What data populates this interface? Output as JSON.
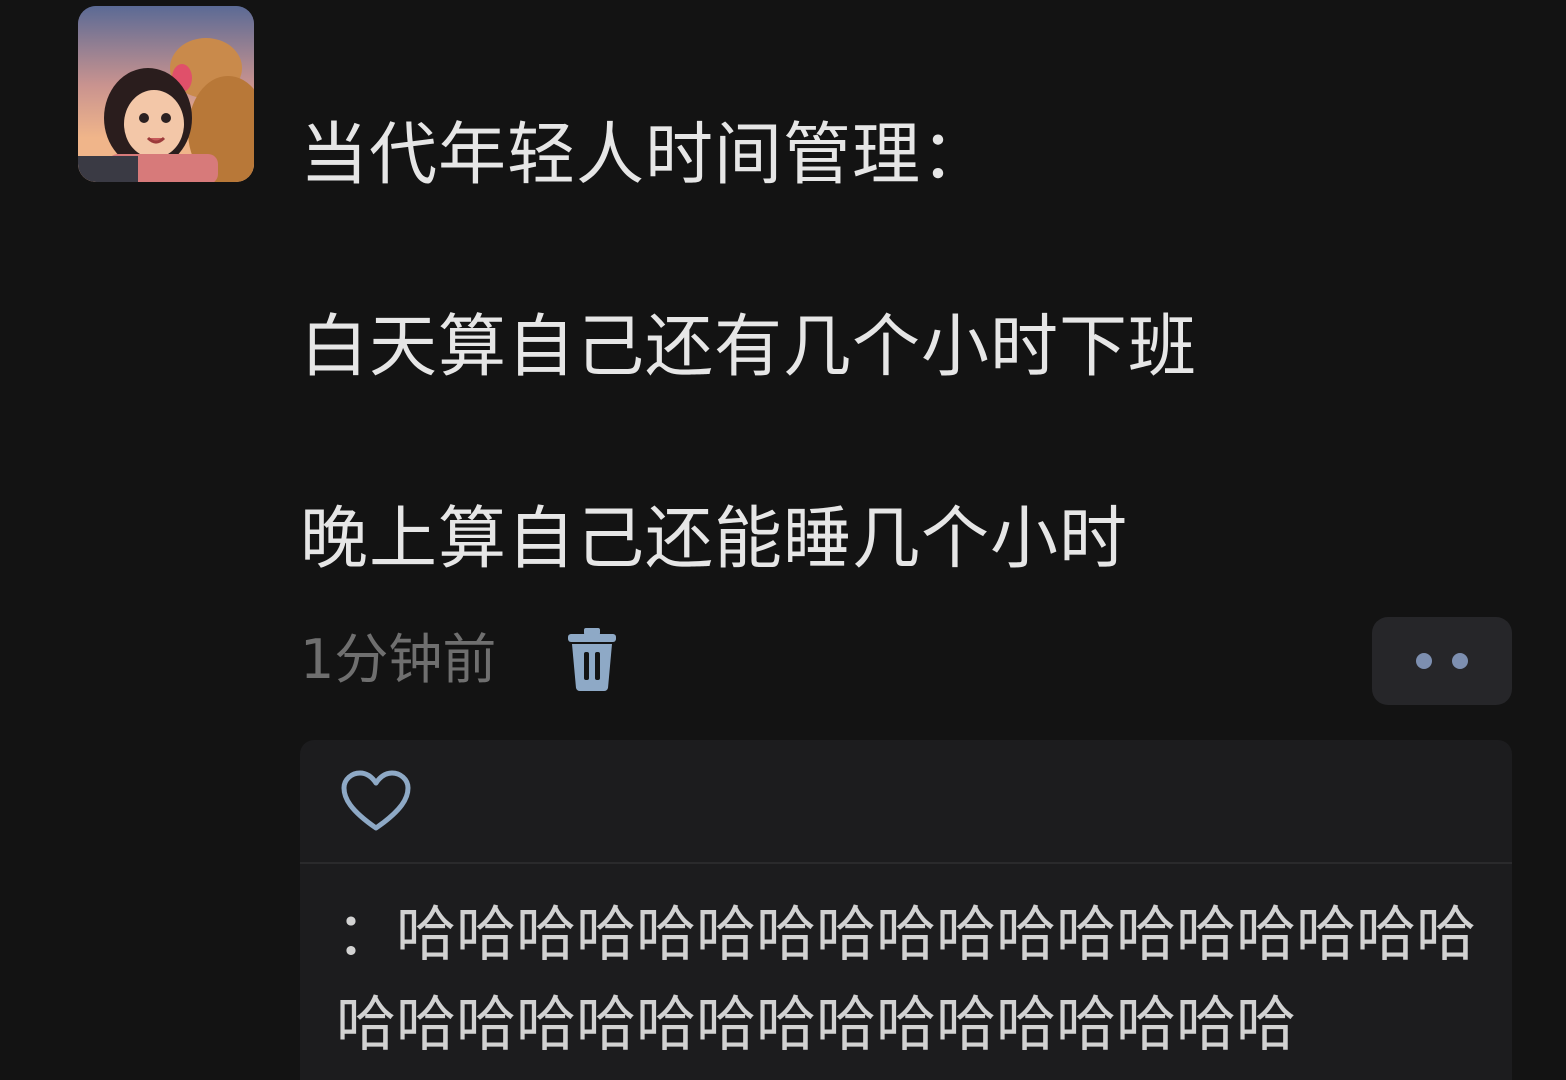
{
  "post": {
    "lines": [
      "当代年轻人时间管理：",
      "白天算自己还有几个小时下班",
      "晚上算自己还能睡几个小时"
    ],
    "time": "1分钟前"
  },
  "icons": {
    "delete": "trash-icon",
    "more": "more-dots-icon",
    "like": "heart-icon"
  },
  "comment": {
    "text": "：哈哈哈哈哈哈哈哈哈哈哈哈哈哈哈哈哈哈哈哈哈哈哈哈哈哈哈哈哈哈哈哈哈哈"
  },
  "colors": {
    "background": "#131313",
    "panel": "#1c1c1e",
    "accent": "#7d8fb0"
  }
}
